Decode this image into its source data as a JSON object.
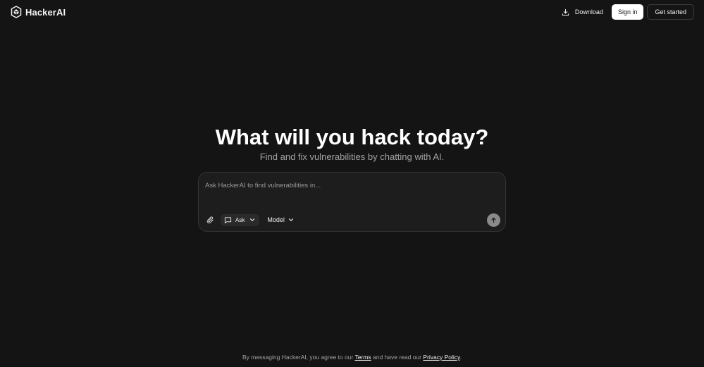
{
  "header": {
    "brand_name": "HackerAI",
    "download_label": "Download",
    "signin_label": "Sign in",
    "getstarted_label": "Get started"
  },
  "hero": {
    "title": "What will you hack today?",
    "subtitle": "Find and fix vulnerabilities by chatting with AI."
  },
  "composer": {
    "placeholder": "Ask HackerAI to find vulnerabilities in...",
    "value": "",
    "mode_label": "Ask",
    "model_label": "Model",
    "icons": {
      "attach": "paperclip-icon",
      "mode": "message-square-icon",
      "send": "arrow-up-icon"
    }
  },
  "footer": {
    "prefix": "By messaging HackerAI, you agree to our ",
    "terms_label": "Terms",
    "middle": " and have read our ",
    "privacy_label": "Privacy Policy",
    "suffix": "."
  },
  "colors": {
    "background": "#141414",
    "composer_bg": "#1d1d1d",
    "primary_button_bg": "#ffffff",
    "send_button_bg": "#8a8a8a"
  }
}
